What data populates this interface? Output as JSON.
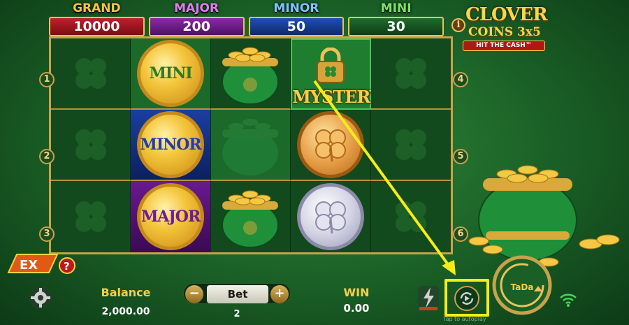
{
  "jackpots": [
    {
      "name": "GRAND",
      "value": "10000",
      "color": "#c0202a"
    },
    {
      "name": "MAJOR",
      "value": "200",
      "color": "#8a2aa8"
    },
    {
      "name": "MINOR",
      "value": "50",
      "color": "#1f4fb8"
    },
    {
      "name": "MINI",
      "value": "30",
      "color": "#1e6e2a"
    }
  ],
  "logo": {
    "title": "CLOVER",
    "sub": "COINS 3x5",
    "tag": "HIT THE CASH™",
    "info_glyph": "i"
  },
  "reels": {
    "rows": [
      [
        "clover-empty",
        "coin-mini",
        "pot-of-gold",
        "mystery-lock",
        "clover-empty"
      ],
      [
        "clover-empty",
        "coin-minor",
        "pot-faded",
        "coin-gold-clover",
        "clover-empty"
      ],
      [
        "clover-empty",
        "coin-major",
        "pot-of-gold",
        "coin-silver-clover",
        "clover-empty"
      ]
    ],
    "coin_labels": {
      "mini": "MINI",
      "minor": "MINOR",
      "major": "MAJOR"
    },
    "mystery_label": "MYSTERY",
    "markers_left": [
      "1",
      "2",
      "3"
    ],
    "markers_right": [
      "4",
      "5",
      "6"
    ]
  },
  "bottom": {
    "ex_badge": "EX",
    "ex_help": "?",
    "balance_label": "Balance",
    "balance_value": "2,000.00",
    "bet_label": "Bet",
    "bet_minus": "−",
    "bet_plus": "+",
    "bet_value": "2",
    "win_label": "WIN",
    "win_value": "0.00",
    "autoplay_hint": "Tap to autoplay",
    "spin_label": "TaDa"
  },
  "annotation": {
    "color": "#f7ec1a"
  }
}
